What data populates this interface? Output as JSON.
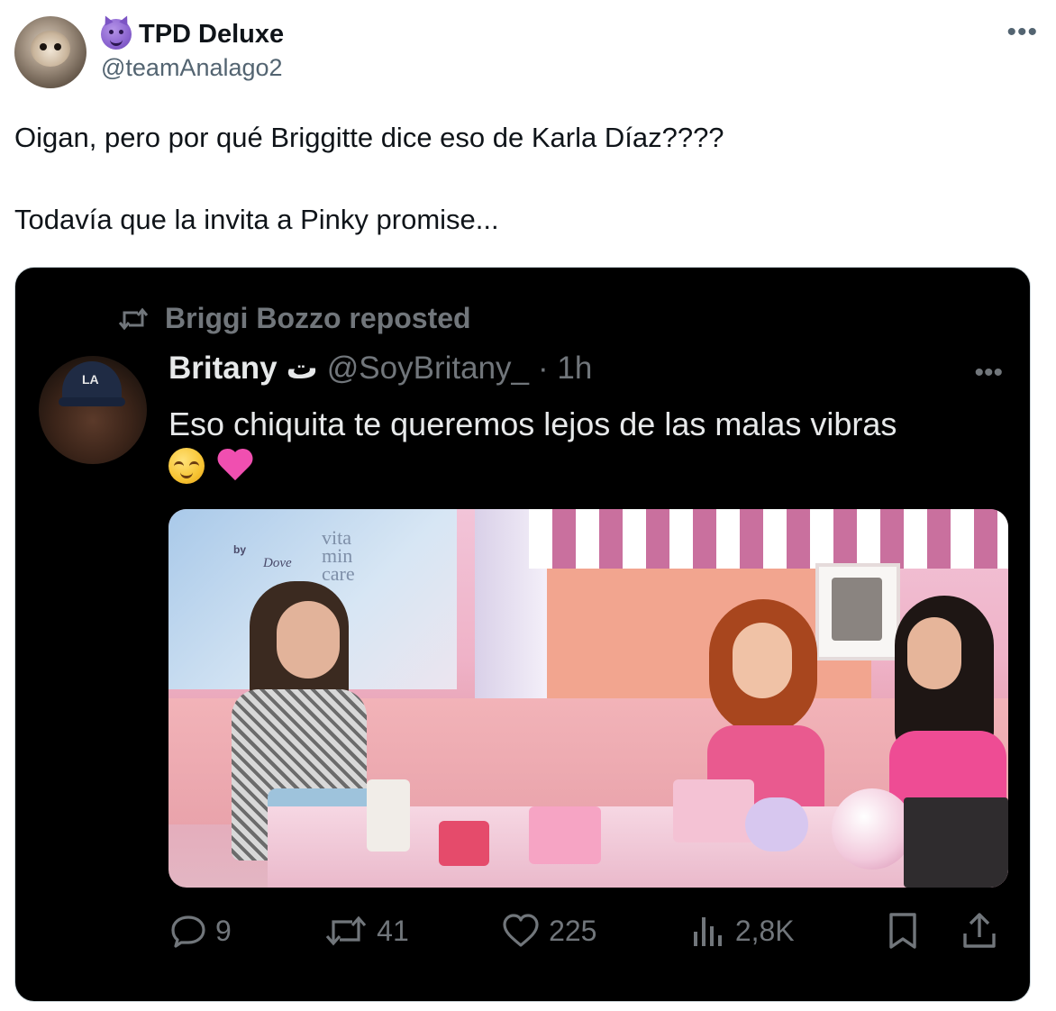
{
  "author": {
    "display_name": "TPD Deluxe",
    "handle": "@teamAnalago2",
    "name_emoji": "smiling-imp-emoji"
  },
  "tweet": {
    "paragraphs": [
      "Oigan, pero por qué Briggitte dice eso de Karla Díaz????",
      "Todavía que la invita a Pinky promise..."
    ]
  },
  "quoted": {
    "repost_label": "Briggi Bozzo reposted",
    "display_name": "Britany",
    "name_suffix": "ت",
    "handle": "@SoyBritany_",
    "time": "· 1h",
    "text": "Eso chiquita te queremos lejos de las malas vibras",
    "emojis": [
      "relieved-face-emoji",
      "pink-heart-emoji"
    ],
    "photo": {
      "by_text": "by",
      "brand_text": "Dove",
      "logo_text": "vita min care"
    },
    "stats": {
      "replies": "9",
      "reposts": "41",
      "likes": "225",
      "views": "2,8K"
    }
  },
  "colors": {
    "card_bg": "#000000",
    "primary_text_dark": "#e7e9ea",
    "secondary_text": "#71767b",
    "heart_pink": "#f04fb0"
  }
}
